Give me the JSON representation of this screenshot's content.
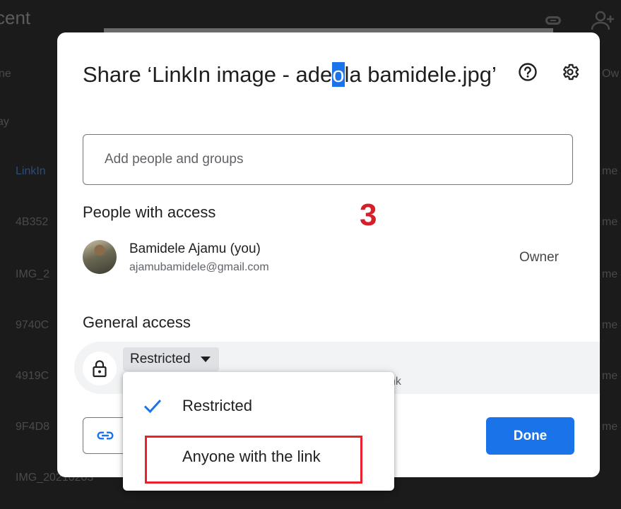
{
  "background": {
    "title_fragment": "cent",
    "left_fragments": [
      "ne",
      "ay",
      "LinkIn",
      "4B352",
      "IMG_2",
      "9740C",
      "4919C",
      "9F4D8",
      "IMG_20210203"
    ],
    "right_fragments": [
      "Ow",
      "me",
      "me",
      "me",
      "me",
      "me",
      "me"
    ]
  },
  "dialog": {
    "title_before": "Share ‘LinkIn image - ade",
    "title_selected": "o",
    "title_after": "la bamidele.jpg’",
    "help_icon": "help-circle-icon",
    "settings_icon": "gear-icon",
    "add_people_placeholder": "Add people and groups",
    "people_with_access_label": "People with access",
    "person": {
      "name": "Bamidele Ajamu (you)",
      "email": "ajamubamidele@gmail.com",
      "role": "Owner"
    },
    "general_access_label": "General access",
    "access_value": "Restricted",
    "access_description_fragment": "nk",
    "done_label": "Done"
  },
  "menu": {
    "items": [
      {
        "label": "Restricted",
        "selected": true
      },
      {
        "label": "Anyone with the link",
        "selected": false
      }
    ]
  },
  "annotation": {
    "step_number": "3",
    "highlight_color": "#e8212b"
  },
  "colors": {
    "accent": "#1a73e8",
    "annotation": "#d4202a"
  }
}
